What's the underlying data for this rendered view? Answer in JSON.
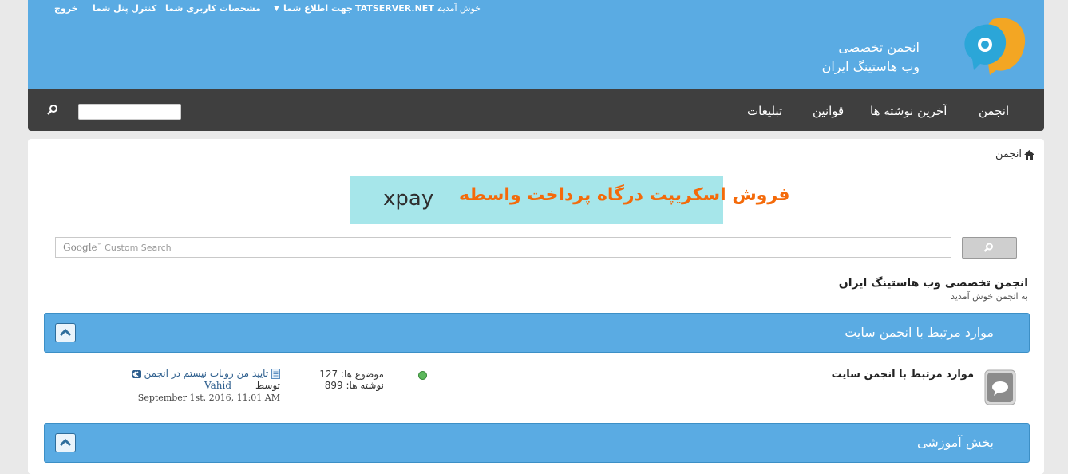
{
  "header": {
    "links": {
      "logout": "خروج",
      "control_panel": "کنترل پنل شما",
      "profile": "مشخصات کاربری شما",
      "notifications": "جهت اطلاع شما",
      "username": "TATSERVER.NET ،",
      "welcome": "خوش آمدید"
    },
    "site_name_line1": "انجمن تخصصی",
    "site_name_line2": "وب هاستینگ ایران"
  },
  "nav": {
    "items": [
      "انجمن",
      "آخرین نوشته ها",
      "قوانین",
      "تبلیغات"
    ],
    "search_placeholder": ""
  },
  "breadcrumb": {
    "label": "انجمن"
  },
  "banner": {
    "text_fa": "فروش اسکریپت درگاه پرداخت واسطه",
    "text_en": "xpay"
  },
  "google_search": {
    "brand": "Google",
    "tm": "™",
    "placeholder": "Custom Search"
  },
  "forum_header": {
    "title": "انجمن تخصصی وب هاستینگ ایران",
    "subtitle": "به انجمن خوش آمدید"
  },
  "categories": [
    {
      "title": "موارد مرتبط با انجمن سایت"
    },
    {
      "title": "بخش آموزشی"
    }
  ],
  "forum_row": {
    "title": "موارد مرتبط با انجمن سایت",
    "threads_label": "موضوع ها:",
    "threads_value": "127",
    "posts_label": "نوشته ها:",
    "posts_value": "899",
    "last_post": {
      "title": "تایید من روبات نیستم در انجمن",
      "by_label": "توسط",
      "user": "Vahid",
      "date": "September 1st, 2016, 11:01 AM"
    }
  },
  "colors": {
    "header_blue": "#5aabe3",
    "nav_dark": "#3f3f3f",
    "banner_bg": "#a6e6ea",
    "banner_orange": "#f46a0a"
  }
}
